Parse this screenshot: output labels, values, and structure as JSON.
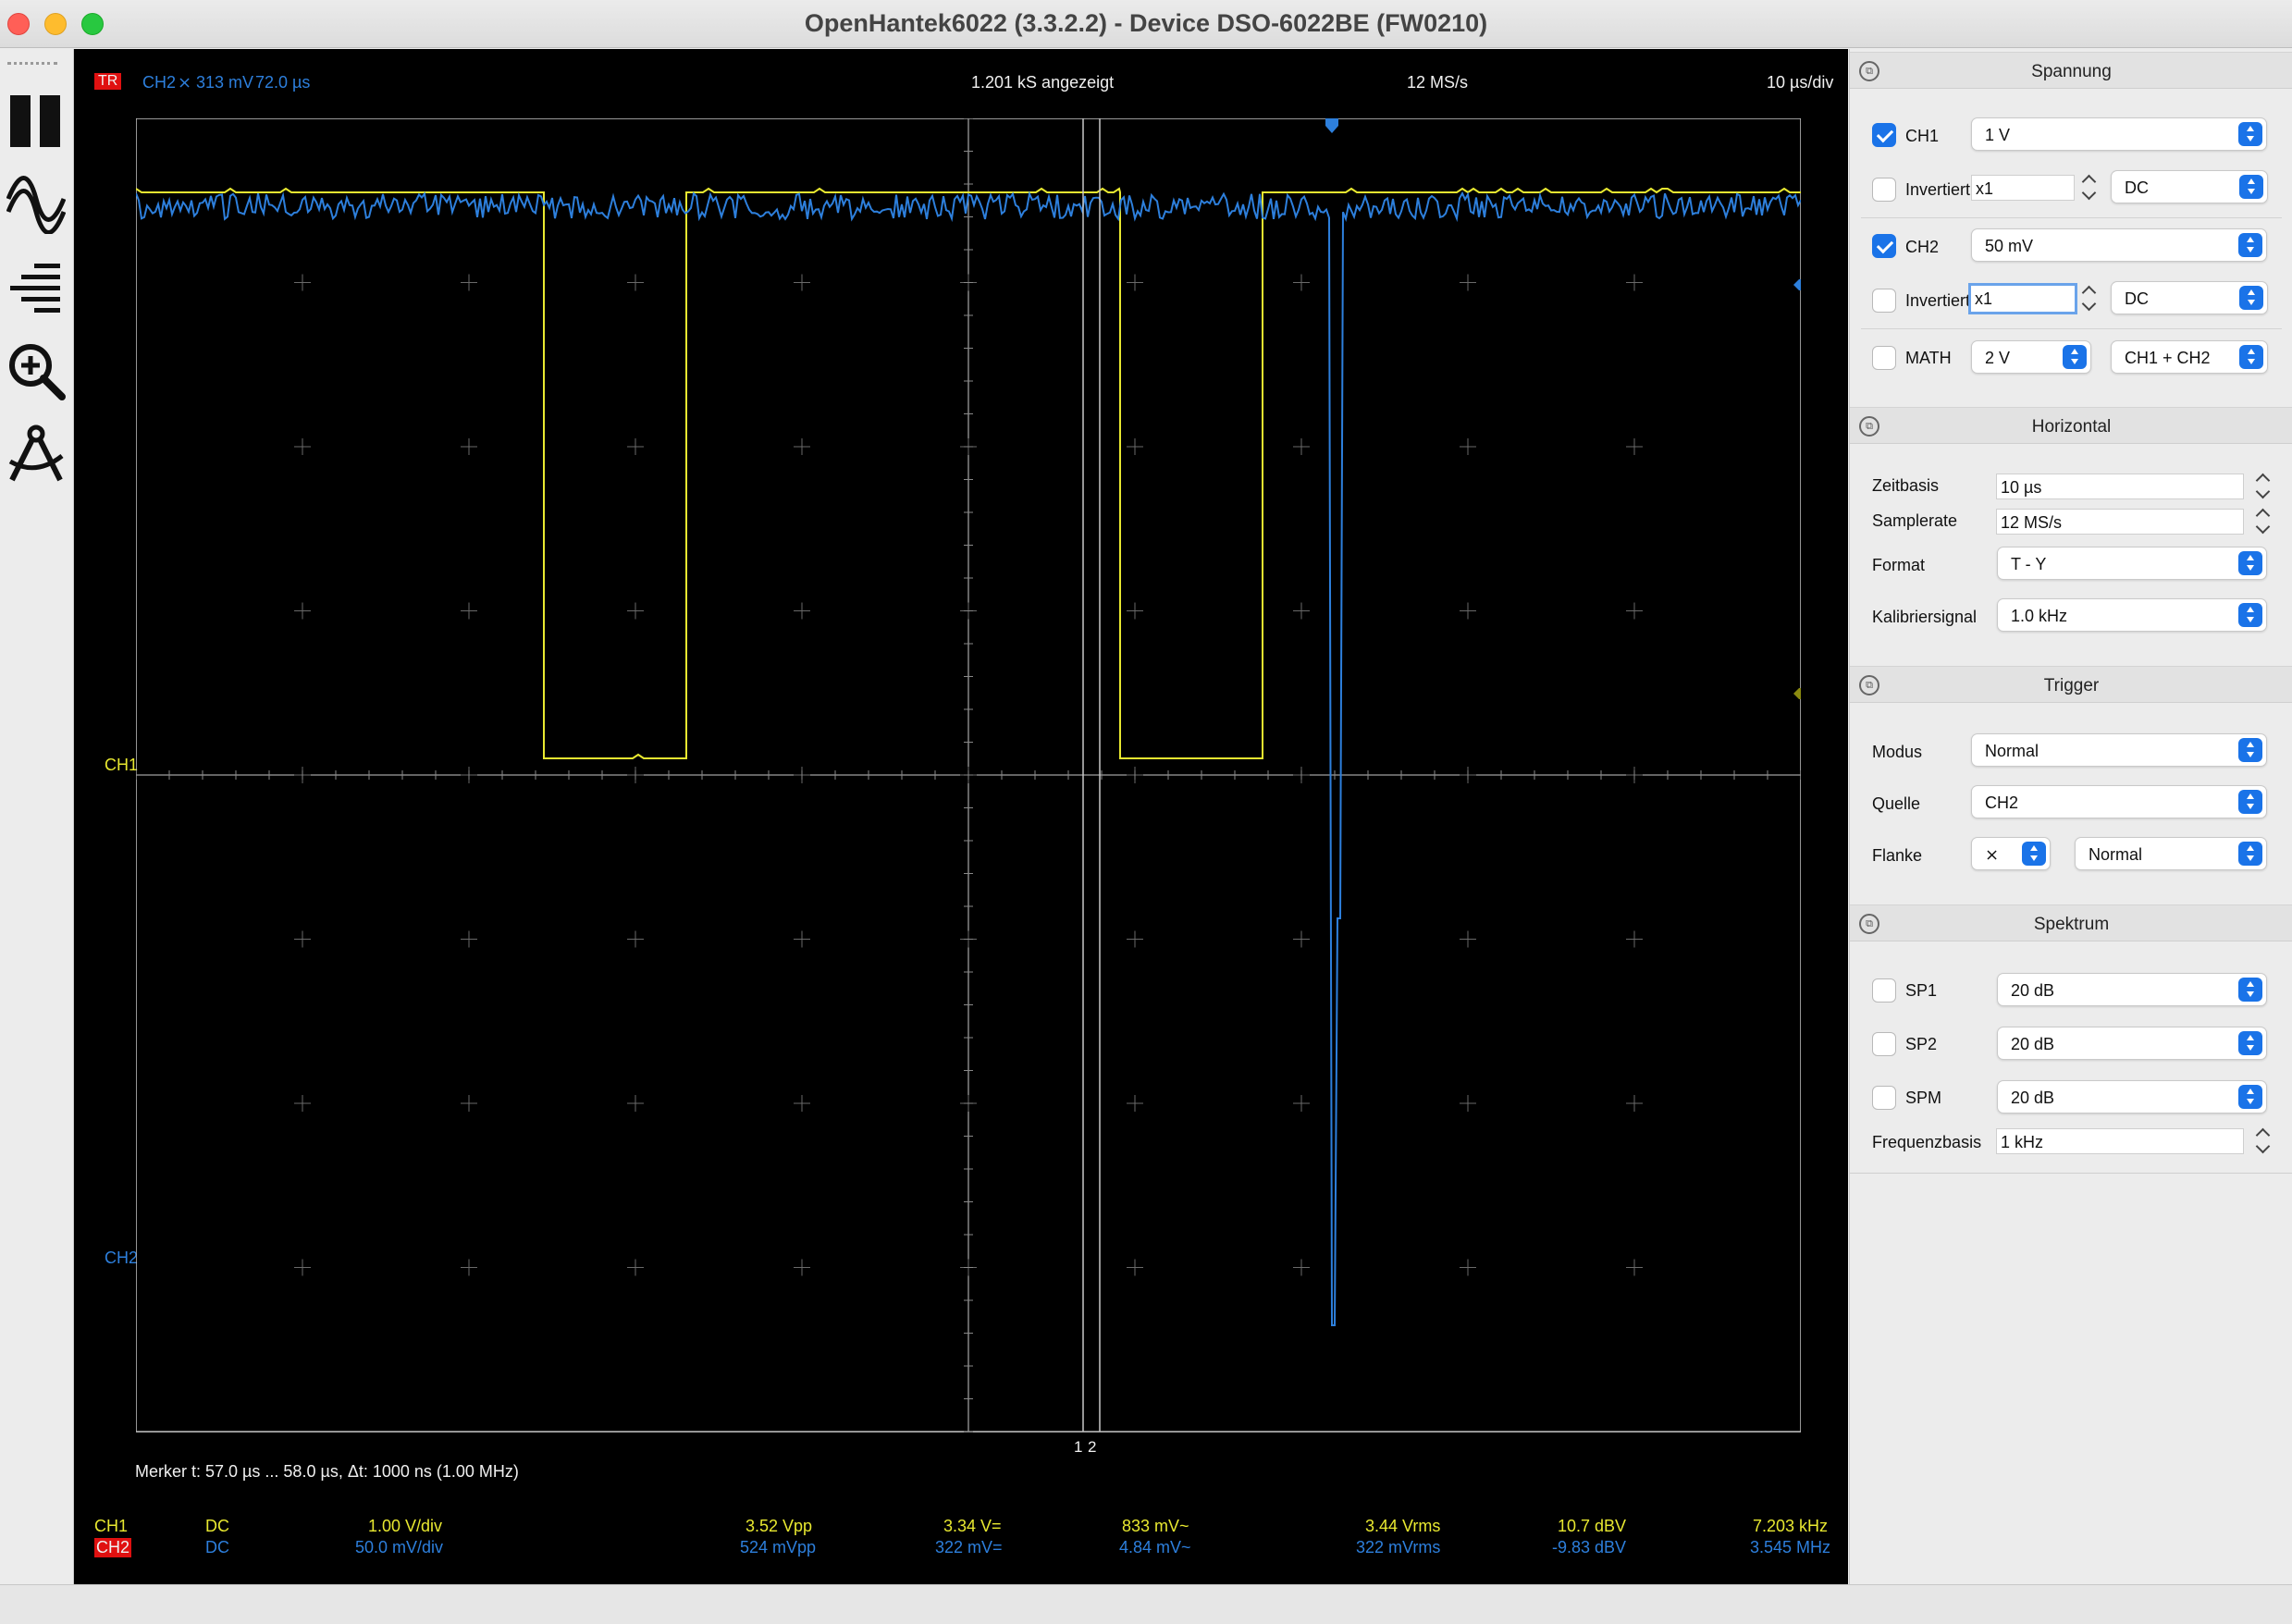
{
  "window": {
    "title": "OpenHantek6022 (3.3.2.2) - Device DSO-6022BE (FW0210)"
  },
  "toolbar": {
    "items": [
      "pause",
      "sine-wave",
      "hamburger-lines",
      "zoom-in",
      "compass"
    ]
  },
  "scope": {
    "trigger_badge": "TR",
    "trigger_info": {
      "channel": "CH2",
      "slope": "⨯",
      "level": "313 mV",
      "position": "72.0 µs"
    },
    "samples_shown": "1.201 kS angezeigt",
    "samplerate": "12 MS/s",
    "timebase": "10 µs/div",
    "ch1_marker": "CH1",
    "ch2_marker": "CH2",
    "cursor_labels": [
      "1",
      "2"
    ],
    "merker": "Merker   t: 57.0 µs ... 58.0 µs,  Δt: 1000 ns (1.00 MHz)",
    "measurements": {
      "ch1": {
        "name": "CH1",
        "coupling": "DC",
        "vdiv": "1.00 V/div",
        "vpp": "3.52 Vpp",
        "vdc": "3.34 V=",
        "vac": "833 mV~",
        "vrms": "3.44 Vrms",
        "dbv": "10.7 dBV",
        "freq": "7.203 kHz"
      },
      "ch2": {
        "name": "CH2",
        "coupling": "DC",
        "vdiv": "50.0 mV/div",
        "vpp": "524 mVpp",
        "vdc": "322 mV=",
        "vac": "4.84 mV~",
        "vrms": "322 mVrms",
        "dbv": "-9.83 dBV",
        "freq": "3.545 MHz"
      }
    },
    "colors": {
      "ch1": "#e8e830",
      "ch2": "#2d7fdc",
      "grid": "#c8c8c8",
      "background": "#000000"
    }
  },
  "dock": {
    "spannung": {
      "title": "Spannung",
      "ch1": {
        "label": "CH1",
        "checked": true,
        "gain": "1 V"
      },
      "ch1_inv": {
        "label": "Invertiert",
        "checked": false,
        "probe": "x1",
        "coupling": "DC"
      },
      "ch2": {
        "label": "CH2",
        "checked": true,
        "gain": "50 mV"
      },
      "ch2_inv": {
        "label": "Invertiert",
        "checked": false,
        "probe": "x1",
        "coupling": "DC"
      },
      "math": {
        "label": "MATH",
        "checked": false,
        "gain": "2 V",
        "mode": "CH1 + CH2"
      }
    },
    "horizontal": {
      "title": "Horizontal",
      "zeitbasis_label": "Zeitbasis",
      "zeitbasis": "10 µs",
      "samplerate_label": "Samplerate",
      "samplerate": "12 MS/s",
      "format_label": "Format",
      "format": "T - Y",
      "kalib_label": "Kalibriersignal",
      "kalib": "1.0 kHz"
    },
    "trigger": {
      "title": "Trigger",
      "modus_label": "Modus",
      "modus": "Normal",
      "quelle_label": "Quelle",
      "quelle": "CH2",
      "flanke_label": "Flanke",
      "flanke": "⨯",
      "flanke_mode": "Normal"
    },
    "spektrum": {
      "title": "Spektrum",
      "sp1": {
        "label": "SP1",
        "checked": false,
        "value": "20 dB"
      },
      "sp2": {
        "label": "SP2",
        "checked": false,
        "value": "20 dB"
      },
      "spm": {
        "label": "SPM",
        "checked": false,
        "value": "20 dB"
      },
      "freqbasis_label": "Frequenzbasis",
      "freqbasis": "1 kHz"
    }
  }
}
